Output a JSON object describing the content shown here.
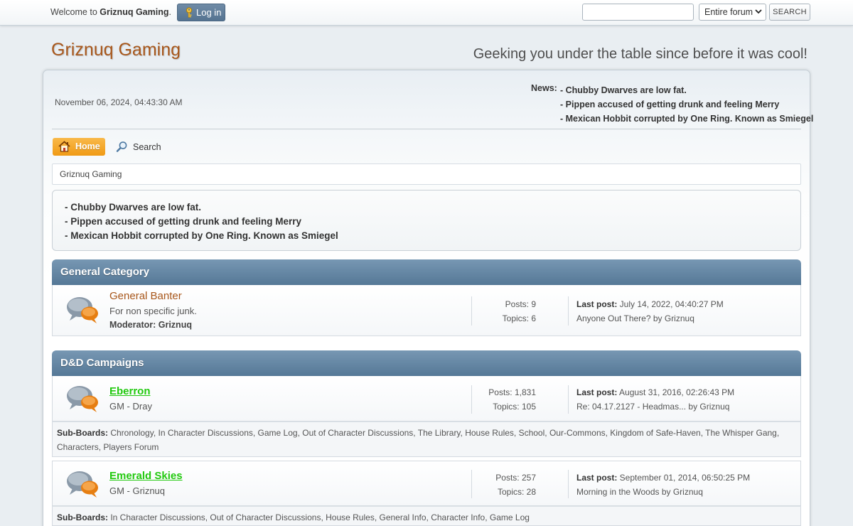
{
  "topbar": {
    "welcome_prefix": "Welcome to ",
    "welcome_site": "Griznuq Gaming",
    "welcome_suffix": ".",
    "login_label": "Log in",
    "search_value": "",
    "search_scope": "Entire forum",
    "search_button": "SEARCH"
  },
  "header": {
    "title": "Griznuq Gaming",
    "slogan": "Geeking you under the table since before it was cool!"
  },
  "upper": {
    "datetime": "November 06, 2024, 04:43:30 AM",
    "news_label": "News:",
    "news_items": [
      "- Chubby Dwarves are low fat.",
      "- Pippen accused of getting drunk and feeling Merry",
      "- Mexican Hobbit corrupted by One Ring. Known as Smiegel"
    ]
  },
  "menu": {
    "home": "Home",
    "search": "Search"
  },
  "breadcrumb": "Griznuq Gaming",
  "newsbox": [
    "- Chubby Dwarves are low fat.",
    "- Pippen accused of getting drunk and feeling Merry",
    "- Mexican Hobbit corrupted by One Ring. Known as Smiegel"
  ],
  "categories": [
    {
      "name": "General Category",
      "boards": [
        {
          "title": "General Banter",
          "description": "For non specific junk.",
          "moderator": "Moderator: Griznuq",
          "posts": "Posts: 9",
          "topics": "Topics: 6",
          "last_post_label": "Last post:",
          "last_post_date": " July 14, 2022, 04:40:27 PM",
          "last_post_topic": "Anyone Out There? by Griznuq"
        }
      ]
    },
    {
      "name": "D&D Campaigns",
      "boards": [
        {
          "title": "Eberron",
          "description": "GM - Dray",
          "posts": "Posts: 1,831",
          "topics": "Topics: 105",
          "last_post_label": "Last post:",
          "last_post_date": " August 31, 2016, 02:26:43 PM",
          "last_post_topic": "Re: 04.17.2127 - Headmas... by Griznuq",
          "subboards_label": "Sub-Boards:",
          "subboards": " Chronology, In Character Discussions, Game Log, Out of Character Discussions, The Library, House Rules, School, Our-Commons, Kingdom of Safe-Haven, The Whisper Gang, Characters, Players Forum"
        },
        {
          "title": "Emerald Skies",
          "description": "GM - Griznuq",
          "posts": "Posts: 257",
          "topics": "Topics: 28",
          "last_post_label": "Last post:",
          "last_post_date": " September 01, 2014, 06:50:25 PM",
          "last_post_topic": "Morning in the Woods by Griznuq",
          "subboards_label": "Sub-Boards:",
          "subboards": " In Character Discussions, Out of Character Discussions, House Rules, General Info, Character Info, Game Log"
        }
      ]
    }
  ],
  "colors": {
    "title_brown": "#a8571b",
    "new_green": "#22c90f",
    "category_blue": "#557896",
    "home_orange": "#f09a14"
  }
}
